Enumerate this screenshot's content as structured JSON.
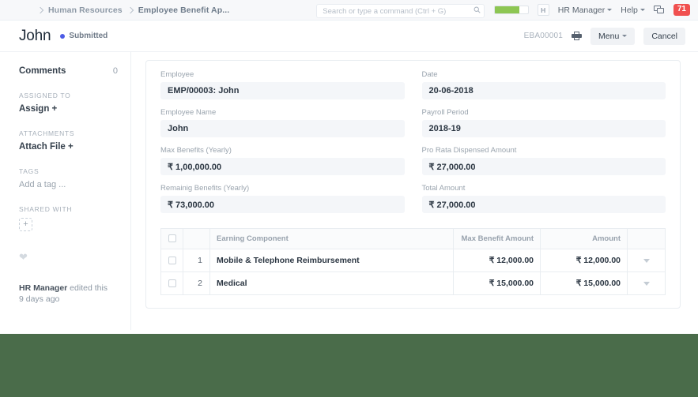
{
  "navbar": {
    "breadcrumb": [
      {
        "label": "Human Resources"
      },
      {
        "label": "Employee Benefit Ap..."
      }
    ],
    "search": {
      "placeholder": "Search or type a command (Ctrl + G)",
      "value": ""
    },
    "progress_percent": 75,
    "avatar_initial": "H",
    "user_menu": "HR Manager",
    "help_menu": "Help",
    "notification_count": "71",
    "colors": {
      "progress_fill": "#8dc653",
      "badge": "#f0504f",
      "nav_bg": "#f7f8fa"
    }
  },
  "titlebar": {
    "title": "John",
    "status": "Submitted",
    "status_color": "#4d5ce6",
    "doc_name": "EBA00001",
    "menu_label": "Menu",
    "cancel_label": "Cancel"
  },
  "sidebar": {
    "comments_label": "Comments",
    "comments_count": "0",
    "assigned_to_head": "ASSIGNED TO",
    "assign_action": "Assign +",
    "attachments_head": "ATTACHMENTS",
    "attach_action": "Attach File +",
    "tags_head": "TAGS",
    "tags_placeholder": "Add a tag ...",
    "shared_with_head": "SHARED WITH",
    "share_add": "+",
    "edited_user": "HR Manager",
    "edited_text": " edited this",
    "edited_time": "9 days ago"
  },
  "form": {
    "left": [
      {
        "label": "Employee",
        "value": "EMP/00003: John"
      },
      {
        "label": "Employee Name",
        "value": "John"
      },
      {
        "label": "Max Benefits (Yearly)",
        "value": "₹ 1,00,000.00"
      },
      {
        "label": "Remainig Benefits (Yearly)",
        "value": "₹ 73,000.00"
      }
    ],
    "right": [
      {
        "label": "Date",
        "value": "20-06-2018"
      },
      {
        "label": "Payroll Period",
        "value": "2018-19"
      },
      {
        "label": "Pro Rata Dispensed Amount",
        "value": "₹ 27,000.00"
      },
      {
        "label": "Total Amount",
        "value": "₹ 27,000.00"
      }
    ]
  },
  "table": {
    "headers": {
      "component": "Earning Component",
      "max_benefit": "Max Benefit Amount",
      "amount": "Amount"
    },
    "rows": [
      {
        "idx": "1",
        "component": "Mobile & Telephone Reimbursement",
        "max_benefit": "₹ 12,000.00",
        "amount": "₹ 12,000.00"
      },
      {
        "idx": "2",
        "component": "Medical",
        "max_benefit": "₹ 15,000.00",
        "amount": "₹ 15,000.00"
      }
    ]
  },
  "footer": {
    "band_color": "#4a6c4a"
  }
}
